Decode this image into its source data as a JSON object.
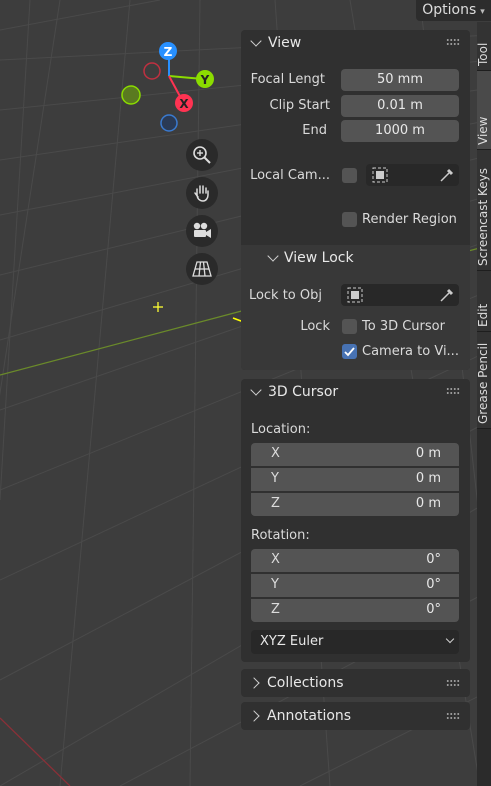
{
  "header": {
    "options_label": "Options"
  },
  "gizmo": {
    "z": "Z",
    "y": "Y",
    "x": "X"
  },
  "nav_buttons": [
    "zoom-icon",
    "hand-pan-icon",
    "camera-icon",
    "grid-perspective-icon"
  ],
  "tabs": [
    {
      "label": "Tool"
    },
    {
      "label": "View",
      "active": true
    },
    {
      "label": "Screencast Keys"
    },
    {
      "label": "Edit"
    },
    {
      "label": "Grease Pencil"
    }
  ],
  "view_panel": {
    "title": "View",
    "focal_length_label": "Focal Lengt",
    "focal_length_value": "50 mm",
    "clip_start_label": "Clip Start",
    "clip_start_value": "0.01 m",
    "clip_end_label": "End",
    "clip_end_value": "1000 m",
    "local_camera_label": "Local Cam...",
    "render_region_label": "Render Region",
    "view_lock": {
      "title": "View Lock",
      "lock_to_obj_label": "Lock to Obj",
      "lock_label": "Lock",
      "to_3d_cursor_label": "To 3D Cursor",
      "to_3d_cursor_checked": false,
      "camera_to_view_label": "Camera to Vi...",
      "camera_to_view_checked": true
    }
  },
  "cursor_panel": {
    "title": "3D Cursor",
    "location_label": "Location:",
    "location": [
      {
        "axis": "X",
        "value": "0 m"
      },
      {
        "axis": "Y",
        "value": "0 m"
      },
      {
        "axis": "Z",
        "value": "0 m"
      }
    ],
    "rotation_label": "Rotation:",
    "rotation": [
      {
        "axis": "X",
        "value": "0°"
      },
      {
        "axis": "Y",
        "value": "0°"
      },
      {
        "axis": "Z",
        "value": "0°"
      }
    ],
    "rotation_mode": "XYZ Euler"
  },
  "collapsed_panels": [
    {
      "title": "Collections"
    },
    {
      "title": "Annotations"
    }
  ],
  "colors": {
    "viewport_bg": "#3d3d3d",
    "panel_bg": "#303030",
    "field_bg": "#545454",
    "accent": "#4772b3",
    "annotation_arrow": "#ffff00",
    "axis_x": "#ff3352",
    "axis_y": "#8bdc00",
    "axis_z": "#2890ff"
  }
}
